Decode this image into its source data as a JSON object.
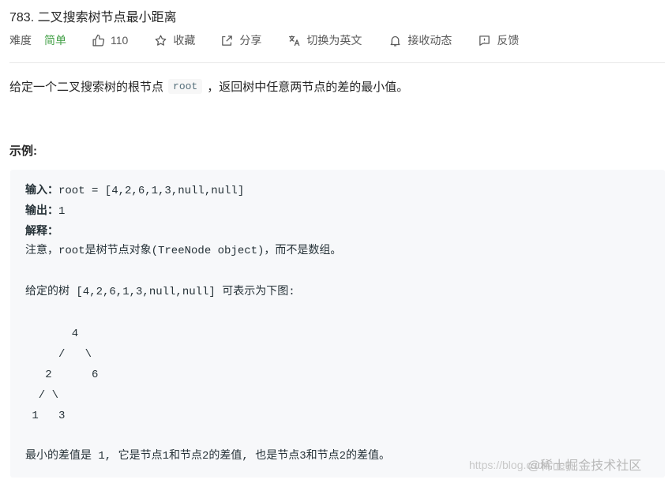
{
  "problem": {
    "title": "783. 二叉搜索树节点最小距离"
  },
  "meta": {
    "difficulty_label": "难度",
    "difficulty_value": "简单",
    "likes": "110",
    "favorite_label": "收藏",
    "share_label": "分享",
    "switch_lang_label": "切换为英文",
    "notify_label": "接收动态",
    "feedback_label": "反馈"
  },
  "description": {
    "before": "给定一个二叉搜索树的根节点",
    "code": "root",
    "after": "，返回树中任意两节点的差的最小值。"
  },
  "example": {
    "heading": "示例:",
    "input_label": "输入：",
    "input_value": "root = [4,2,6,1,3,null,null]",
    "output_label": "输出：",
    "output_value": "1",
    "explain_label": "解释：",
    "note": "注意，root是树节点对象(TreeNode object)，而不是数组。",
    "tree_intro": "给定的树 [4,2,6,1,3,null,null] 可表示为下图:",
    "tree_lines": [
      "       4",
      "     /   \\",
      "   2      6",
      "  / \\",
      " 1   3"
    ],
    "conclusion": "最小的差值是 1, 它是节点1和节点2的差值, 也是节点3和节点2的差值。"
  },
  "watermark": {
    "url": "https://blog.csdn.net/",
    "brand": "@稀土掘金技术社区"
  },
  "colors": {
    "easy": "#43a047",
    "text": "#262626",
    "muted": "#595959",
    "box_bg": "#f7f8fa"
  }
}
